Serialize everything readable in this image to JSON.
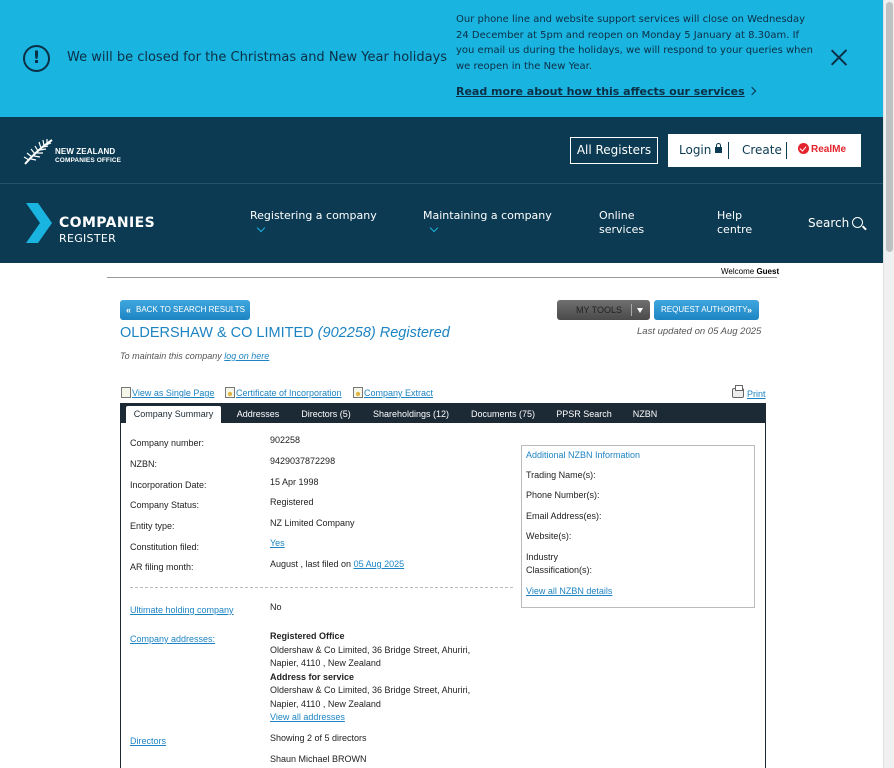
{
  "banner": {
    "icon": "info-exclamation-icon",
    "title": "We will be closed for the Christmas and New Year holidays",
    "body": "Our phone line and website support services will close on Wednesday 24 December at 5pm and reopen on Monday 5 January at 8.30am. If you email us during the holidays, we will respond to your queries when we reopen in the New Year.",
    "link": "Read more about how this affects our services"
  },
  "header": {
    "org_line1": "NEW ZEALAND",
    "org_line2": "COMPANIES OFFICE",
    "all_registers": "All Registers",
    "login": "Login",
    "create": "Create",
    "realme": "RealMe",
    "brand_line1": "COMPANIES",
    "brand_line2": "REGISTER",
    "nav": {
      "registering": "Registering a company",
      "maintaining": "Maintaining a company",
      "online": "Online services",
      "help": "Help centre",
      "search": "Search"
    }
  },
  "welcome": {
    "prefix": "Welcome",
    "user": "Guest"
  },
  "actions": {
    "back": "BACK TO SEARCH RESULTS",
    "tools": "MY TOOLS",
    "request": "REQUEST AUTHORITY"
  },
  "company": {
    "name": "OLDERSHAW & CO LIMITED",
    "number_paren": "(902258)",
    "status_word": "Registered",
    "last_updated": "Last updated on 05 Aug 2025",
    "maintain_prefix": "To maintain this company",
    "maintain_link": "log on here"
  },
  "tools": {
    "single_page": "View as Single Page",
    "certificate": "Certificate of Incorporation",
    "extract": "Company Extract",
    "print": "Print"
  },
  "tabs": [
    "Company Summary",
    "Addresses",
    "Directors (5)",
    "Shareholdings (12)",
    "Documents (75)",
    "PPSR Search",
    "NZBN"
  ],
  "summary": {
    "labels": {
      "number": "Company number:",
      "nzbn": "NZBN:",
      "incorporation": "Incorporation Date:",
      "status": "Company Status:",
      "entity": "Entity type:",
      "constitution": "Constitution filed:",
      "ar_month": "AR filing month:"
    },
    "values": {
      "number": "902258",
      "nzbn": "9429037872298",
      "incorporation": "15 Apr 1998",
      "status": "Registered",
      "entity": "NZ Limited Company",
      "constitution": "Yes",
      "ar_month_prefix": "August , last filed on",
      "ar_month_date": "05 Aug 2025"
    },
    "ultimate_label": "Ultimate holding company",
    "ultimate_value": "No",
    "addresses_label": "Company addresses:",
    "registered_office_heading": "Registered Office",
    "registered_office_line1": "Oldershaw & Co Limited, 36 Bridge Street, Ahuriri,",
    "registered_office_line2": "Napier, 4110 , New Zealand",
    "service_heading": "Address for service",
    "service_line1": "Oldershaw & Co Limited, 36 Bridge Street, Ahuriri,",
    "service_line2": "Napier, 4110 , New Zealand",
    "view_all_addresses": "View all addresses",
    "directors_label": "Directors",
    "directors_showing": "Showing 2 of 5 directors",
    "director_1": "Shaun Michael BROWN"
  },
  "nzbn_info": {
    "title": "Additional NZBN Information",
    "trading": "Trading Name(s):",
    "phone": "Phone Number(s):",
    "email": "Email Address(es):",
    "website": "Website(s):",
    "industry1": "Industry",
    "industry2": "Classification(s):",
    "view_all": "View all NZBN details"
  },
  "colors": {
    "banner_bg": "#1ab4e0",
    "header_bg": "#0b3a52",
    "link_blue": "#1d84c3",
    "tab_bar": "#1c2a36",
    "realme_red": "#e4232c"
  }
}
